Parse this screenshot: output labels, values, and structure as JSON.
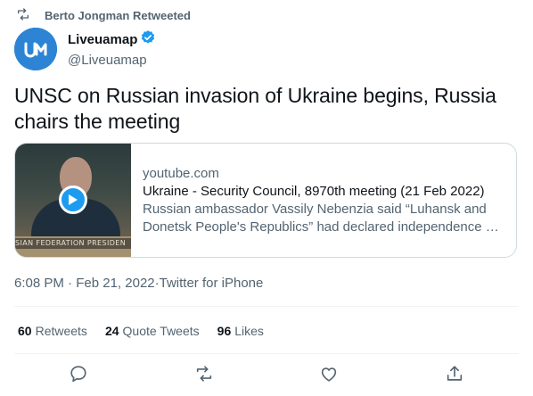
{
  "retweet": {
    "label": "Berto Jongman Retweeted"
  },
  "author": {
    "name": "Liveuamap",
    "handle": "@Liveuamap",
    "verified": true
  },
  "tweet": {
    "text": "UNSC on Russian invasion of Ukraine begins, Russia chairs the meeting"
  },
  "card": {
    "domain": "youtube.com",
    "title": "Ukraine - Security Council, 8970th meeting (21 Feb 2022)",
    "description": "Russian ambassador Vassily Nebenzia said “Luhansk and Donetsk People's Republics” had declared independence …",
    "thumb_plate": "SIAN FEDERATION   PRESIDEN"
  },
  "meta": {
    "time": "6:08 PM",
    "sep1": " · ",
    "date": "Feb 21, 2022",
    "sep2": " · ",
    "client": "Twitter for iPhone"
  },
  "stats": {
    "retweets_count": "60",
    "retweets_label": "Retweets",
    "quotes_count": "24",
    "quotes_label": "Quote Tweets",
    "likes_count": "96",
    "likes_label": "Likes"
  },
  "actions": [
    "reply-icon",
    "retweet-icon",
    "like-icon",
    "share-icon"
  ],
  "colors": {
    "accent": "#1d9bf0",
    "muted": "#536471",
    "text": "#0f1419"
  }
}
